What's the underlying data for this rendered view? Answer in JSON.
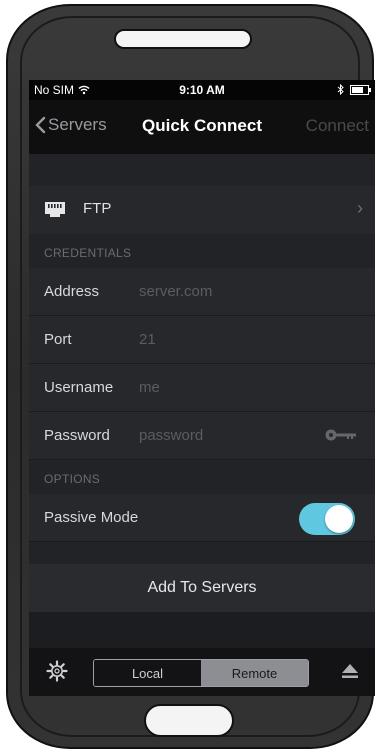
{
  "status_bar": {
    "carrier": "No SIM",
    "time": "9:10 AM"
  },
  "nav": {
    "back_label": "Servers",
    "title": "Quick Connect",
    "connect_label": "Connect"
  },
  "protocol": {
    "label": "FTP",
    "icon": "ethernet-port-icon"
  },
  "credentials": {
    "header": "CREDENTIALS",
    "fields": [
      {
        "label": "Address",
        "placeholder": "server.com"
      },
      {
        "label": "Port",
        "placeholder": "21"
      },
      {
        "label": "Username",
        "placeholder": "me"
      },
      {
        "label": "Password",
        "placeholder": "password"
      }
    ]
  },
  "options": {
    "header": "OPTIONS",
    "passive_mode_label": "Passive Mode",
    "passive_mode_on": true
  },
  "add_to_servers_label": "Add To Servers",
  "bottom_bar": {
    "local_label": "Local",
    "remote_label": "Remote",
    "selected": "Remote"
  },
  "colors": {
    "toggle_on": "#5fc8e0",
    "screen_bg": "#1c1d20",
    "row_bg": "#27282c"
  }
}
